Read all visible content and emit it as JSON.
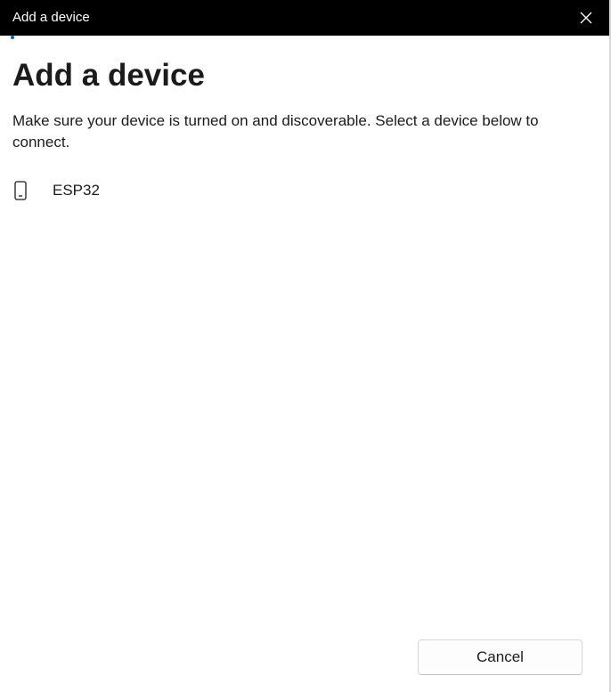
{
  "window": {
    "title": "Add a device"
  },
  "main": {
    "heading": "Add a device",
    "instructions": "Make sure your device is turned on and discoverable. Select a device below to connect."
  },
  "devices": [
    {
      "name": "ESP32",
      "icon": "phone-icon"
    }
  ],
  "footer": {
    "cancel_label": "Cancel"
  },
  "colors": {
    "titlebar": "#000000",
    "accent": "#0067c0"
  }
}
